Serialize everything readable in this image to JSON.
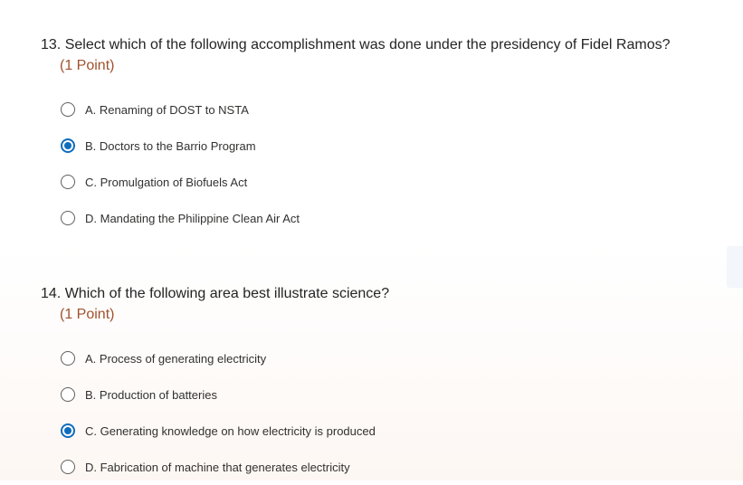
{
  "questions": [
    {
      "title": "13. Select which of the following accomplishment was done under the presidency of Fidel Ramos?",
      "points": "(1 Point)",
      "selected_index": 1,
      "options": [
        {
          "label": "A. Renaming of DOST to NSTA",
          "selected": false
        },
        {
          "label": "B. Doctors to the Barrio Program",
          "selected": true
        },
        {
          "label": "C. Promulgation of Biofuels Act",
          "selected": false
        },
        {
          "label": "D. Mandating the Philippine Clean Air Act",
          "selected": false
        }
      ]
    },
    {
      "title": "14. Which of the following area best illustrate science?",
      "points": "(1 Point)",
      "selected_index": 2,
      "options": [
        {
          "label": "A. Process of generating electricity",
          "selected": false
        },
        {
          "label": "B. Production of batteries",
          "selected": false
        },
        {
          "label": "C. Generating knowledge on how electricity is produced",
          "selected": true
        },
        {
          "label": "D. Fabrication of machine that generates electricity",
          "selected": false
        }
      ]
    }
  ],
  "colors": {
    "accent": "#0f6cbd",
    "points_text": "#a0522d",
    "question_text": "#242424",
    "option_text": "#323130"
  }
}
